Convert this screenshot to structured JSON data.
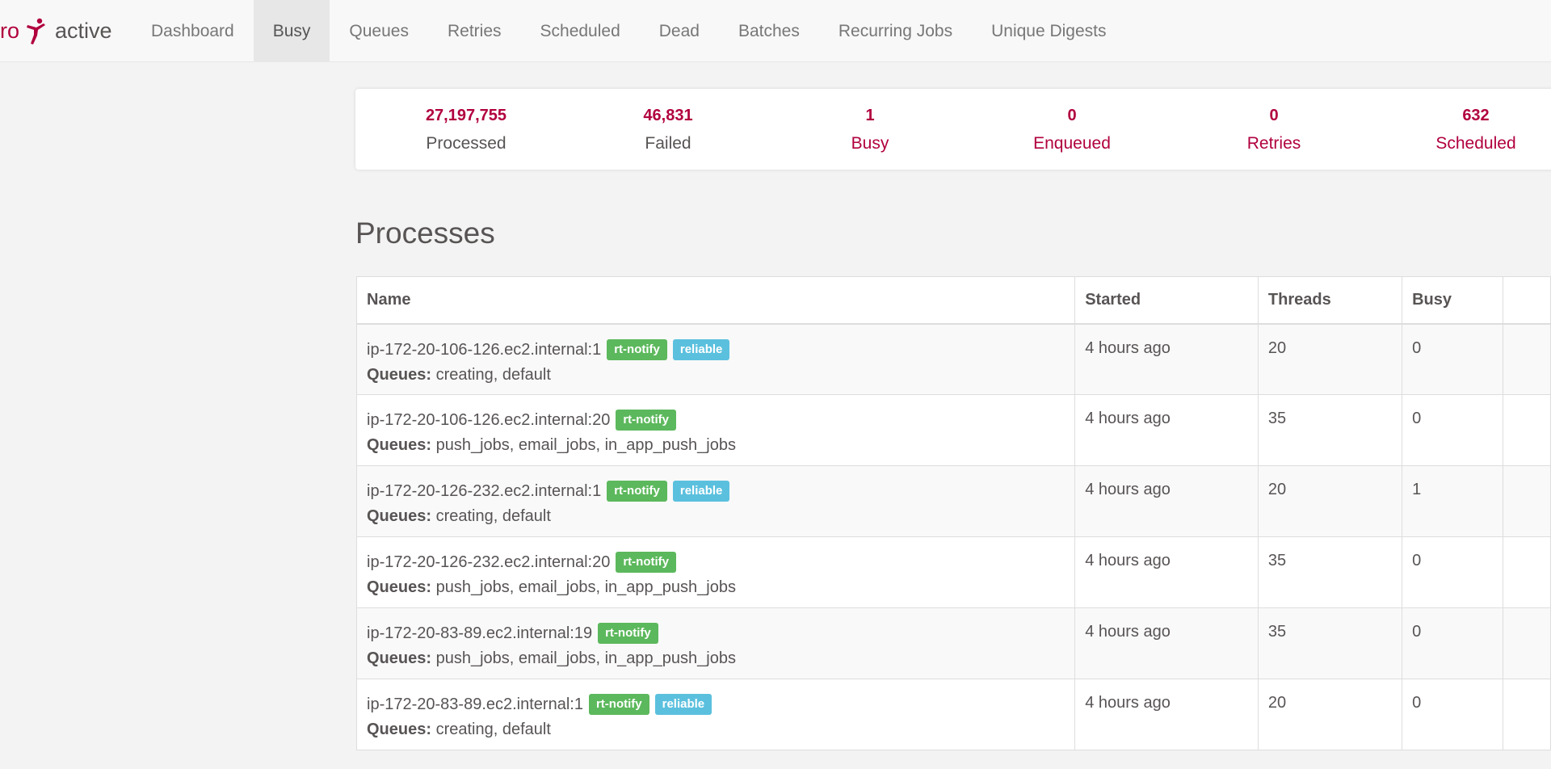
{
  "brand": {
    "prefix": "ro",
    "suffix": "active"
  },
  "nav": {
    "items": [
      {
        "label": "Dashboard"
      },
      {
        "label": "Busy"
      },
      {
        "label": "Queues"
      },
      {
        "label": "Retries"
      },
      {
        "label": "Scheduled"
      },
      {
        "label": "Dead"
      },
      {
        "label": "Batches"
      },
      {
        "label": "Recurring Jobs"
      },
      {
        "label": "Unique Digests"
      }
    ],
    "active": "Busy"
  },
  "summary": {
    "stats": [
      {
        "count": "27,197,755",
        "label": "Processed"
      },
      {
        "count": "46,831",
        "label": "Failed"
      },
      {
        "count": "1",
        "label": "Busy"
      },
      {
        "count": "0",
        "label": "Enqueued"
      },
      {
        "count": "0",
        "label": "Retries"
      },
      {
        "count": "632",
        "label": "Scheduled"
      }
    ]
  },
  "processes": {
    "title": "Processes",
    "columns": [
      "Name",
      "Started",
      "Threads",
      "Busy"
    ],
    "queues_label": "Queues:",
    "rows": [
      {
        "name": "ip-172-20-106-126.ec2.internal:1",
        "tags": [
          "rt-notify",
          "reliable"
        ],
        "queues": "creating, default",
        "started": "4 hours ago",
        "threads": "20",
        "busy": "0"
      },
      {
        "name": "ip-172-20-106-126.ec2.internal:20",
        "tags": [
          "rt-notify"
        ],
        "queues": "push_jobs, email_jobs, in_app_push_jobs",
        "started": "4 hours ago",
        "threads": "35",
        "busy": "0"
      },
      {
        "name": "ip-172-20-126-232.ec2.internal:1",
        "tags": [
          "rt-notify",
          "reliable"
        ],
        "queues": "creating, default",
        "started": "4 hours ago",
        "threads": "20",
        "busy": "1"
      },
      {
        "name": "ip-172-20-126-232.ec2.internal:20",
        "tags": [
          "rt-notify"
        ],
        "queues": "push_jobs, email_jobs, in_app_push_jobs",
        "started": "4 hours ago",
        "threads": "35",
        "busy": "0"
      },
      {
        "name": "ip-172-20-83-89.ec2.internal:19",
        "tags": [
          "rt-notify"
        ],
        "queues": "push_jobs, email_jobs, in_app_push_jobs",
        "started": "4 hours ago",
        "threads": "35",
        "busy": "0"
      },
      {
        "name": "ip-172-20-83-89.ec2.internal:1",
        "tags": [
          "rt-notify",
          "reliable"
        ],
        "queues": "creating, default",
        "started": "4 hours ago",
        "threads": "20",
        "busy": "0"
      }
    ]
  },
  "colors": {
    "accent": "#b1003e",
    "tag_rt_notify": "#5cb85c",
    "tag_reliable": "#5bc0de"
  },
  "icons": {
    "logo": "karate-kick-icon"
  }
}
